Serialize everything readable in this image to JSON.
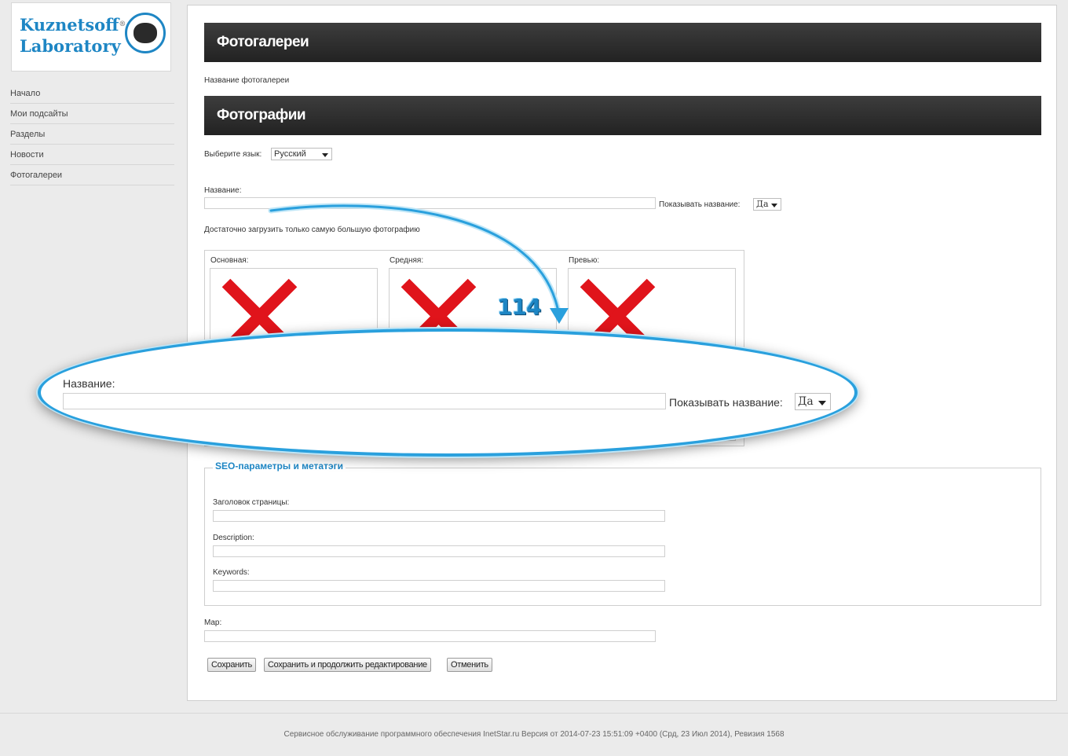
{
  "brand": {
    "line1": "Kuznetsoff",
    "line2": "Laboratory",
    "reg": "®"
  },
  "nav": {
    "items": [
      {
        "label": "Начало"
      },
      {
        "label": "Мои подсайты"
      },
      {
        "label": "Разделы"
      },
      {
        "label": "Новости"
      },
      {
        "label": "Фотогалереи"
      }
    ]
  },
  "page": {
    "title": "Фотогалереи",
    "gallery_name_label": "Название фотогалереи",
    "photos_title": "Фотографии",
    "language_label": "Выберите язык:",
    "language_value": "Русский",
    "name_label": "Название:",
    "name_value": "",
    "show_name_label": "Показывать название:",
    "show_name_value": "Да",
    "upload_hint": "Достаточно загрузить только самую большую фотографию",
    "photo_slots": [
      "Основная:",
      "Средняя:",
      "Превью:"
    ],
    "seo": {
      "legend": "SEO-параметры и метатэги",
      "page_title_label": "Заголовок страницы:",
      "description_label": "Description:",
      "keywords_label": "Keywords:"
    },
    "map_label": "Map:",
    "buttons": {
      "save": "Сохранить",
      "save_continue": "Сохранить и продолжить редактирование",
      "cancel": "Отменить"
    }
  },
  "callout": {
    "number": "114",
    "name_label": "Название:",
    "show_name_label": "Показывать название:",
    "show_name_value": "Да",
    "color": "#2aa0dd"
  },
  "footer": {
    "text": "Сервисное обслуживание программного обеспечения InetStar.ru  Версия от 2014-07-23 15:51:09 +0400 (Срд, 23 Июл 2014), Ревизия 1568"
  },
  "colors": {
    "accent": "#1e86c4",
    "header_bar": "#2b2b2b",
    "error_x": "#e0141b"
  }
}
